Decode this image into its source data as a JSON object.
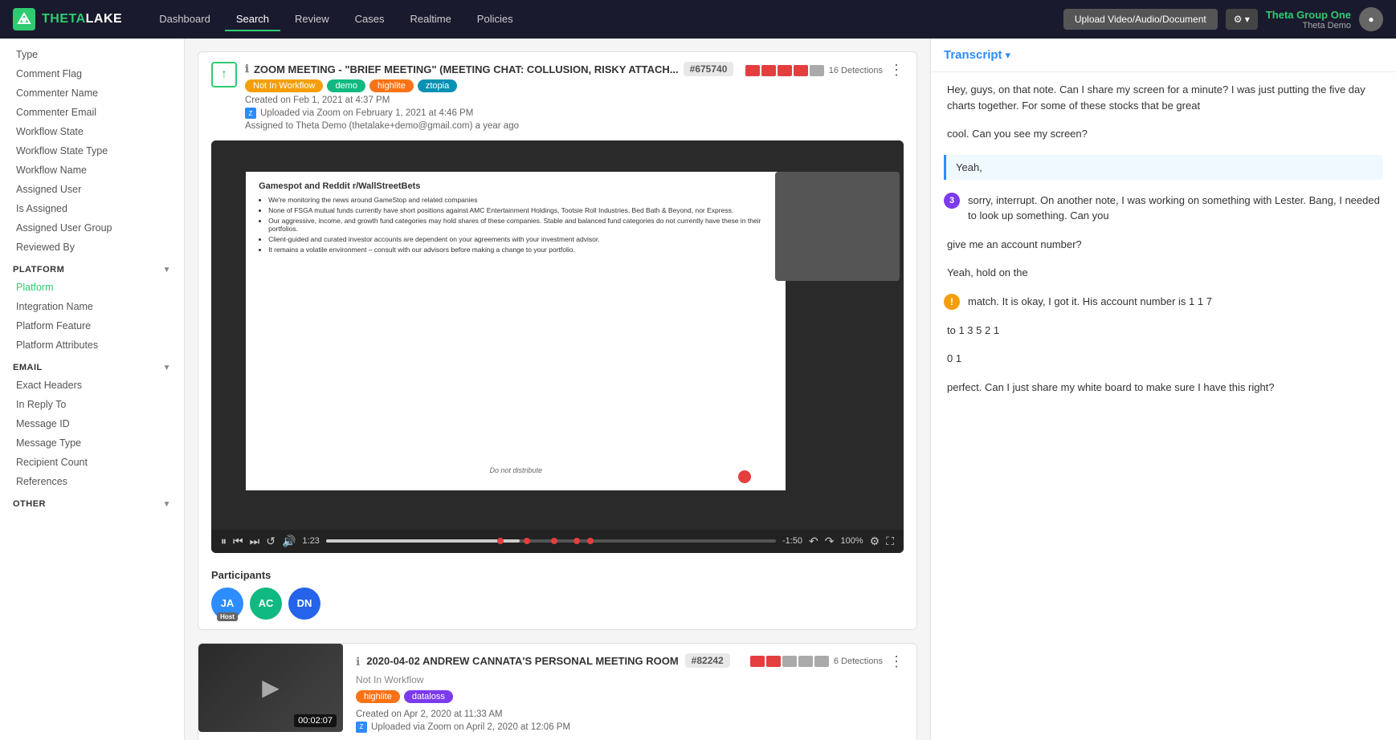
{
  "nav": {
    "logo_main": "THETA",
    "logo_sub": "LAKE",
    "items": [
      "Dashboard",
      "Search",
      "Review",
      "Cases",
      "Realtime",
      "Policies"
    ],
    "active": "Search",
    "upload_btn": "Upload  Video/Audio/Document",
    "user_name": "Theta Group One",
    "user_sub": "Theta Demo"
  },
  "sidebar": {
    "sections": [
      {
        "name": "PLATFORM",
        "items": [
          "Platform",
          "Integration Name",
          "Platform Feature",
          "Platform Attributes"
        ]
      },
      {
        "name": "EMAIL",
        "items": [
          "Exact Headers",
          "In Reply To",
          "Message ID",
          "Message Type",
          "Recipient Count",
          "References"
        ]
      },
      {
        "name": "OTHER",
        "items": []
      }
    ],
    "top_items": [
      "Type",
      "Comment Flag",
      "Commenter Name",
      "Commenter Email",
      "Workflow State",
      "Workflow State Type",
      "Workflow Name",
      "Assigned User",
      "Is Assigned",
      "Assigned User Group",
      "Reviewed By"
    ]
  },
  "card1": {
    "title": "ZOOM MEETING - \"BRIEF MEETING\" (MEETING CHAT: COLLUSION, RISKY ATTACH...",
    "id": "#675740",
    "tags": [
      "Not In Workflow",
      "demo",
      "highlite",
      "ztopia"
    ],
    "tag_colors": [
      "yellow",
      "green",
      "orange",
      "teal"
    ],
    "created": "Created on Feb 1, 2021 at 4:37 PM",
    "uploaded": "Uploaded via Zoom on February 1, 2021 at 4:46 PM",
    "assigned": "Assigned to Theta Demo (thetalake+demo@gmail.com) a year ago",
    "detections": "16 Detections",
    "slide": {
      "title": "Gamespot and Reddit r/WallStreetBets",
      "bullets": [
        "We're monitoring the news around GameStop and related companies",
        "None of FSGA mutual funds currently have short positions against AMC Entertainment Holdings, Tootsie Roll Industries, Bed Bath & Beyond, nor Express.",
        "Our aggressive, income, and growth fund categories may hold shares of these companies. Stable and balanced fund categories do not currently have these in their portfolios.",
        "Client-guided and curated investor accounts are dependent on your agreements with your investment advisor.",
        "It remains a volatile environment – consult with our advisors before making a change to your portfolio."
      ],
      "footer": "Do not distribute"
    },
    "controls": {
      "time_elapsed": "1:23",
      "time_remaining": "-1:50",
      "zoom": "100%"
    },
    "participants_title": "Participants",
    "participants": [
      {
        "initials": "JA",
        "color": "#2d8cff",
        "host": true
      },
      {
        "initials": "AC",
        "color": "#10b981",
        "host": false
      },
      {
        "initials": "DN",
        "color": "#2563eb",
        "host": false
      }
    ]
  },
  "card2": {
    "title": "2020-04-02 ANDREW CANNATA'S PERSONAL MEETING ROOM",
    "id": "#82242",
    "status": "Not In Workflow",
    "tags": [
      "highlite",
      "dataloss"
    ],
    "tag_colors": [
      "orange",
      "purple"
    ],
    "created": "Created on Apr 2, 2020 at 11:33 AM",
    "uploaded": "Uploaded via Zoom on April 2, 2020 at 12:06 PM",
    "detections": "6 Detections",
    "duration": "00:02:07"
  },
  "transcript": {
    "title": "Transcript",
    "entries": [
      {
        "type": "plain",
        "text": "Hey, guys, on that note. Can I share my screen for a minute? I was just putting the five day charts together. For some of these stocks that be great"
      },
      {
        "type": "plain",
        "text": "cool. Can you see my screen?"
      },
      {
        "type": "highlight",
        "text": "Yeah,"
      },
      {
        "type": "badge",
        "badge": "3",
        "badge_color": "purple",
        "text": "sorry, interrupt. On another note, I was working on something with Lester. Bang, I needed to look up something. Can you"
      },
      {
        "type": "plain",
        "text": "give me an account number?"
      },
      {
        "type": "plain",
        "text": "Yeah, hold on the"
      },
      {
        "type": "warning",
        "text": "match. It is okay, I got it. His account number is 1 1 7"
      },
      {
        "type": "plain",
        "text": "to 1 3 5 2 1"
      },
      {
        "type": "plain",
        "text": "0 1"
      },
      {
        "type": "plain",
        "text": "perfect. Can I just share my white board to make sure I have this right?"
      }
    ]
  }
}
